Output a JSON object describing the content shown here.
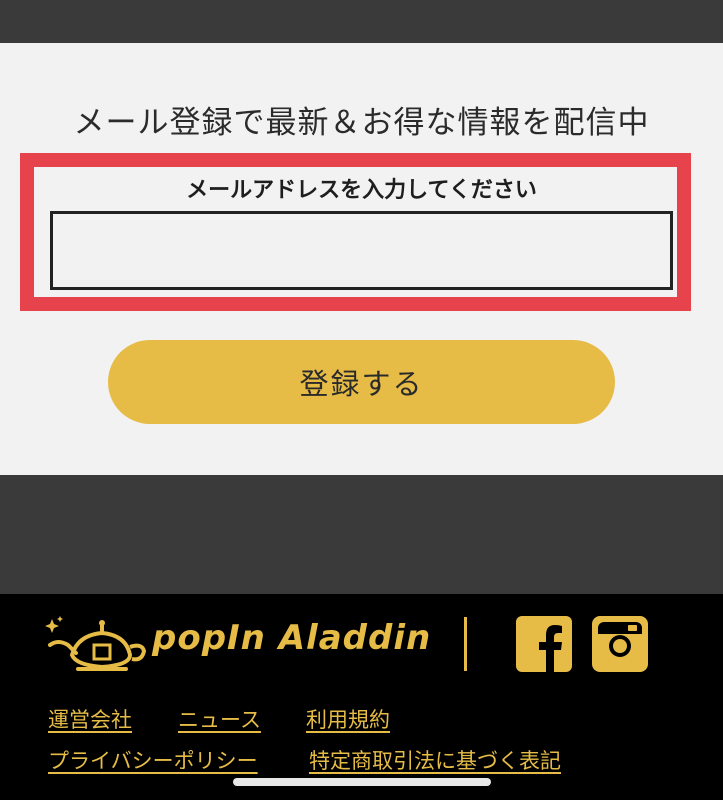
{
  "signup": {
    "heading": "メール登録で最新＆お得な情報を配信中",
    "email_label": "メールアドレスを入力してください",
    "email_value": "",
    "submit_label": "登録する"
  },
  "brand": {
    "name": "popIn Aladdin",
    "accent_color": "#e6bc47",
    "highlight_color": "#e6434d"
  },
  "social": {
    "icons": [
      "facebook-icon",
      "instagram-icon"
    ]
  },
  "footer": {
    "links_row1": [
      "運営会社",
      "ニュース",
      "利用規約"
    ],
    "links_row2": [
      "プライバシーポリシー",
      "特定商取引法に基づく表記"
    ]
  }
}
